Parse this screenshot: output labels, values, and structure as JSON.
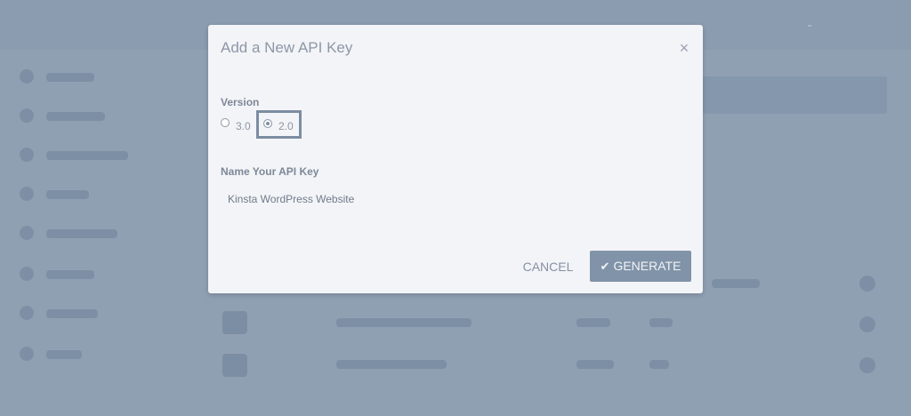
{
  "modal": {
    "title": "Add a New API Key",
    "close_icon": "×",
    "version": {
      "label": "Version",
      "options": [
        {
          "label": "3.0",
          "checked": false
        },
        {
          "label": "2.0",
          "checked": true
        }
      ]
    },
    "name": {
      "label": "Name Your API Key",
      "value": "Kinsta WordPress Website"
    },
    "buttons": {
      "cancel": "CANCEL",
      "generate": "GENERATE",
      "generate_icon": "✔"
    }
  },
  "colors": {
    "backdrop": "#8d9db0",
    "modal_bg": "#f3f4f7",
    "accent": "#8193a8",
    "text": "#8c97a8"
  }
}
